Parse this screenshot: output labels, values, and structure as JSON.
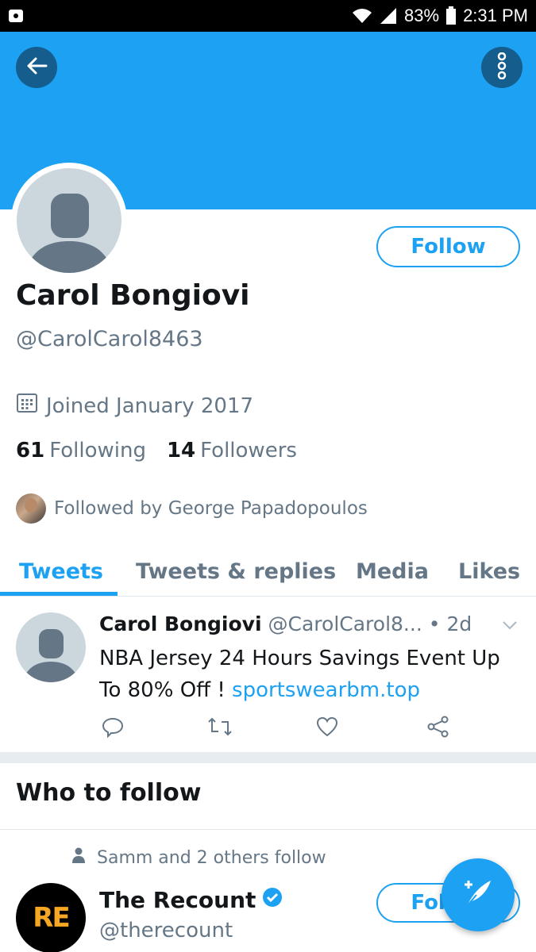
{
  "status_bar": {
    "battery": "83%",
    "time": "2:31 PM"
  },
  "colors": {
    "brand": "#1da1f2",
    "banner": "#1da1f2",
    "muted_text": "#657786",
    "dark_text": "#14171a"
  },
  "header": {
    "back_icon": "arrow-left-icon",
    "menu_icon": "more-vertical-icon"
  },
  "profile": {
    "follow_label": "Follow",
    "name": "Carol  Bongiovi",
    "handle": "@CarolCarol8463",
    "joined": "Joined January 2017",
    "following_count": "61",
    "following_label": "Following",
    "followers_count": "14",
    "followers_label": "Followers",
    "followed_by": "Followed by George Papadopoulos"
  },
  "tabs": [
    {
      "label": "Tweets",
      "active": true
    },
    {
      "label": "Tweets & replies",
      "active": false
    },
    {
      "label": "Media",
      "active": false
    },
    {
      "label": "Likes",
      "active": false
    }
  ],
  "tweet": {
    "name": "Carol  Bongiovi",
    "handle": "@CarolCarol8...",
    "time": "• 2d",
    "text": "NBA Jersey 24 Hours Savings Event Up To 80% Off ! ",
    "link": "sportswearbm.top"
  },
  "who_to_follow": {
    "title": "Who to follow",
    "social_context": "Samm and 2 others follow",
    "account_logo": "RE",
    "account_name": "The Recount",
    "account_handle": "@therecount",
    "follow_label": "Follow"
  }
}
